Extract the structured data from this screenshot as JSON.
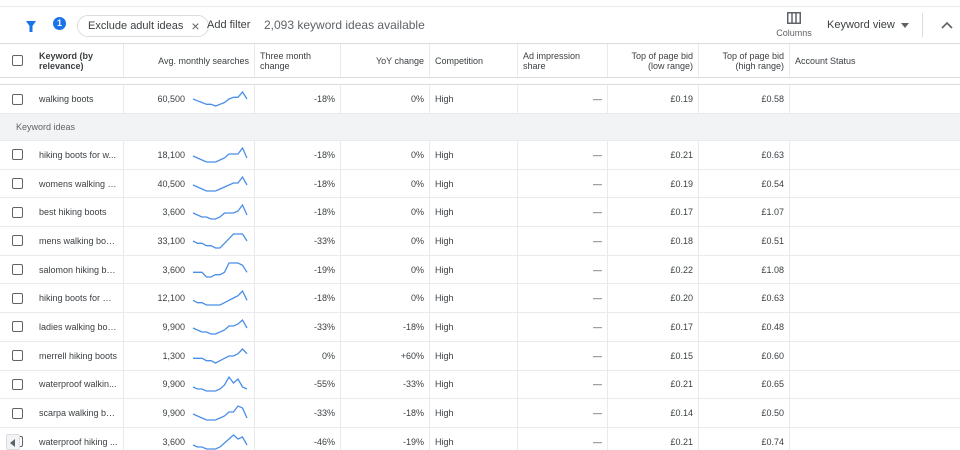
{
  "toolbar": {
    "filter_badge": "1",
    "chip_label": "Exclude adult ideas",
    "chip_close": "×",
    "add_filter": "Add filter",
    "ideas_count": "2,093 keyword ideas available",
    "columns_label": "Columns",
    "view_label": "Keyword view"
  },
  "colors": {
    "accent": "#1a73e8",
    "sparkline": "#4a8fe7"
  },
  "headers": {
    "keyword": "Keyword (by relevance)",
    "avg": "Avg. monthly searches",
    "three_month": "Three month change",
    "yoy": "YoY change",
    "competition": "Competition",
    "ad_share": "Ad impression share",
    "bid_low": "Top of page bid (low range)",
    "bid_high": "Top of page bid (high range)",
    "account": "Account Status"
  },
  "section_label": "Keyword ideas",
  "seed_row": {
    "keyword": "walking boots",
    "avg": "60,500",
    "three_month": "-18%",
    "yoy": "0%",
    "competition": "High",
    "ad_share": "—",
    "bid_low": "£0.19",
    "bid_high": "£0.58",
    "trend": [
      6,
      5,
      4,
      3,
      3,
      2,
      3,
      4,
      6,
      7,
      7,
      10,
      6
    ]
  },
  "rows": [
    {
      "keyword": "hiking boots for w...",
      "avg": "18,100",
      "three_month": "-18%",
      "yoy": "0%",
      "competition": "High",
      "ad_share": "—",
      "bid_low": "£0.21",
      "bid_high": "£0.63",
      "trend": [
        6,
        5,
        4,
        3,
        3,
        3,
        4,
        5,
        7,
        7,
        7,
        10,
        5
      ]
    },
    {
      "keyword": "womens walking b...",
      "avg": "40,500",
      "three_month": "-18%",
      "yoy": "0%",
      "competition": "High",
      "ad_share": "—",
      "bid_low": "£0.19",
      "bid_high": "£0.54",
      "trend": [
        6,
        5,
        4,
        3,
        3,
        3,
        4,
        5,
        6,
        7,
        7,
        10,
        6
      ]
    },
    {
      "keyword": "best hiking boots",
      "avg": "3,600",
      "three_month": "-18%",
      "yoy": "0%",
      "competition": "High",
      "ad_share": "—",
      "bid_low": "£0.17",
      "bid_high": "£1.07",
      "trend": [
        6,
        5,
        4,
        4,
        3,
        3,
        4,
        6,
        6,
        6,
        7,
        10,
        5
      ]
    },
    {
      "keyword": "mens walking boots",
      "avg": "33,100",
      "three_month": "-33%",
      "yoy": "0%",
      "competition": "High",
      "ad_share": "—",
      "bid_low": "£0.18",
      "bid_high": "£0.51",
      "trend": [
        6,
        5,
        5,
        4,
        4,
        3,
        3,
        5,
        7,
        9,
        9,
        9,
        6
      ]
    },
    {
      "keyword": "salomon hiking bo...",
      "avg": "3,600",
      "three_month": "-19%",
      "yoy": "0%",
      "competition": "High",
      "ad_share": "—",
      "bid_low": "£0.22",
      "bid_high": "£1.08",
      "trend": [
        5,
        5,
        5,
        3,
        3,
        4,
        4,
        5,
        9,
        9,
        9,
        8,
        5
      ]
    },
    {
      "keyword": "hiking boots for men",
      "avg": "12,100",
      "three_month": "-18%",
      "yoy": "0%",
      "competition": "High",
      "ad_share": "—",
      "bid_low": "£0.20",
      "bid_high": "£0.63",
      "trend": [
        6,
        5,
        5,
        4,
        4,
        4,
        4,
        5,
        6,
        7,
        8,
        10,
        6
      ]
    },
    {
      "keyword": "ladies walking boots",
      "avg": "9,900",
      "three_month": "-33%",
      "yoy": "-18%",
      "competition": "High",
      "ad_share": "—",
      "bid_low": "£0.17",
      "bid_high": "£0.48",
      "trend": [
        6,
        5,
        4,
        4,
        3,
        3,
        4,
        5,
        7,
        7,
        8,
        10,
        6
      ]
    },
    {
      "keyword": "merrell hiking boots",
      "avg": "1,300",
      "three_month": "0%",
      "yoy": "+60%",
      "competition": "High",
      "ad_share": "—",
      "bid_low": "£0.15",
      "bid_high": "£0.60",
      "trend": [
        5,
        5,
        5,
        4,
        4,
        3,
        4,
        5,
        6,
        6,
        7,
        9,
        7
      ]
    },
    {
      "keyword": "waterproof walkin...",
      "avg": "9,900",
      "three_month": "-55%",
      "yoy": "-33%",
      "competition": "High",
      "ad_share": "—",
      "bid_low": "£0.21",
      "bid_high": "£0.65",
      "trend": [
        5,
        4,
        4,
        3,
        3,
        3,
        4,
        6,
        10,
        7,
        9,
        5,
        4
      ]
    },
    {
      "keyword": "scarpa walking bo...",
      "avg": "9,900",
      "three_month": "-33%",
      "yoy": "-18%",
      "competition": "High",
      "ad_share": "—",
      "bid_low": "£0.14",
      "bid_high": "£0.50",
      "trend": [
        6,
        5,
        4,
        3,
        3,
        3,
        4,
        5,
        7,
        7,
        10,
        9,
        4
      ]
    },
    {
      "keyword": "waterproof hiking ...",
      "avg": "3,600",
      "three_month": "-46%",
      "yoy": "-19%",
      "competition": "High",
      "ad_share": "—",
      "bid_low": "£0.21",
      "bid_high": "£0.74",
      "trend": [
        5,
        4,
        4,
        3,
        3,
        3,
        4,
        6,
        8,
        10,
        8,
        9,
        5
      ]
    }
  ]
}
